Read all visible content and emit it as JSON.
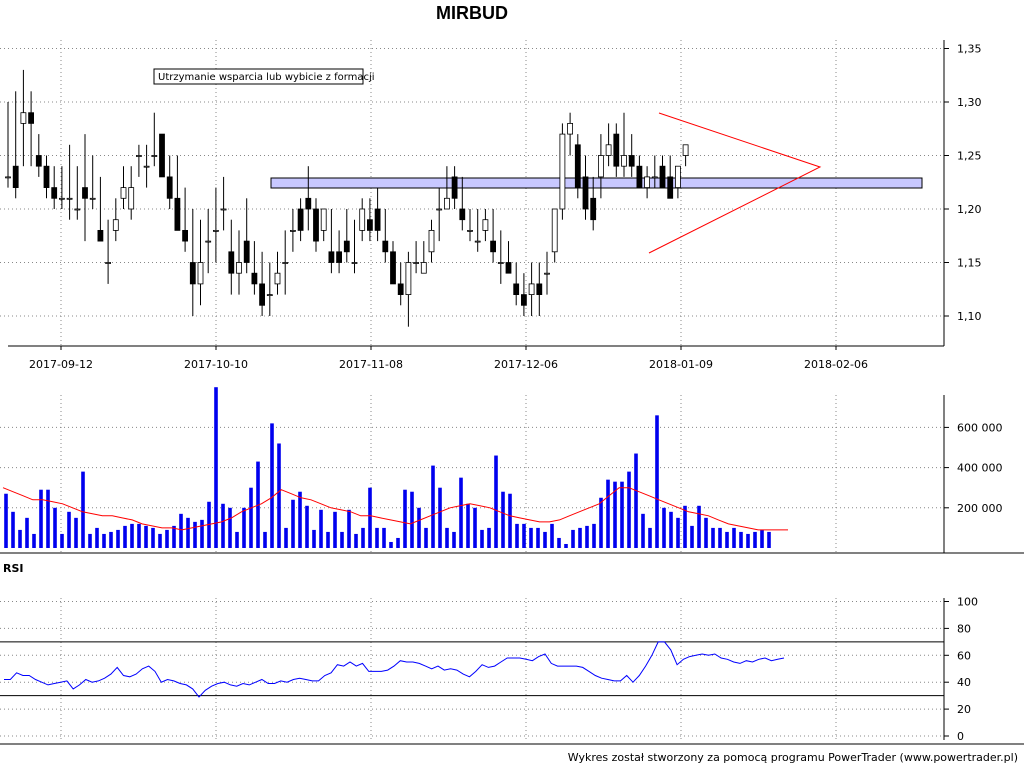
{
  "chart_data": [
    {
      "type": "candlestick",
      "title": "MIRBUD",
      "annotation": "Utrzymanie wsparcia lub wybicie z formacji",
      "x_ticks": [
        "2017-09-12",
        "2017-10-10",
        "2017-11-08",
        "2017-12-06",
        "2018-01-09",
        "2018-02-06"
      ],
      "y_ticks": [
        "1,10",
        "1,15",
        "1,20",
        "1,25",
        "1,30",
        "1,35"
      ],
      "ylim": [
        1.08,
        1.37
      ],
      "grid": true,
      "support_zone": [
        1.221,
        1.231
      ],
      "triangle": {
        "top": [
          1.29,
          1.24
        ],
        "bottom": [
          1.16,
          1.24
        ]
      },
      "ohlc": [
        [
          1.23,
          1.3,
          1.22,
          1.23
        ],
        [
          1.24,
          1.31,
          1.21,
          1.22
        ],
        [
          1.28,
          1.33,
          1.24,
          1.29
        ],
        [
          1.29,
          1.31,
          1.24,
          1.28
        ],
        [
          1.25,
          1.27,
          1.23,
          1.24
        ],
        [
          1.24,
          1.25,
          1.21,
          1.22
        ],
        [
          1.22,
          1.24,
          1.2,
          1.21
        ],
        [
          1.21,
          1.24,
          1.2,
          1.21
        ],
        [
          1.21,
          1.26,
          1.19,
          1.21
        ],
        [
          1.2,
          1.24,
          1.19,
          1.2
        ],
        [
          1.22,
          1.27,
          1.17,
          1.21
        ],
        [
          1.21,
          1.25,
          1.2,
          1.21
        ],
        [
          1.18,
          1.23,
          1.17,
          1.17
        ],
        [
          1.15,
          1.19,
          1.13,
          1.15
        ],
        [
          1.18,
          1.21,
          1.17,
          1.19
        ],
        [
          1.21,
          1.24,
          1.2,
          1.22
        ],
        [
          1.2,
          1.24,
          1.19,
          1.22
        ],
        [
          1.25,
          1.26,
          1.23,
          1.25
        ],
        [
          1.24,
          1.26,
          1.22,
          1.24
        ],
        [
          1.25,
          1.29,
          1.24,
          1.25
        ],
        [
          1.27,
          1.27,
          1.23,
          1.23
        ],
        [
          1.23,
          1.25,
          1.2,
          1.21
        ],
        [
          1.21,
          1.25,
          1.18,
          1.18
        ],
        [
          1.18,
          1.22,
          1.16,
          1.17
        ],
        [
          1.15,
          1.2,
          1.1,
          1.13
        ],
        [
          1.13,
          1.19,
          1.11,
          1.15
        ],
        [
          1.17,
          1.2,
          1.14,
          1.17
        ],
        [
          1.18,
          1.22,
          1.15,
          1.18
        ],
        [
          1.2,
          1.23,
          1.18,
          1.2
        ],
        [
          1.16,
          1.19,
          1.12,
          1.14
        ],
        [
          1.14,
          1.18,
          1.12,
          1.15
        ],
        [
          1.17,
          1.21,
          1.14,
          1.15
        ],
        [
          1.14,
          1.17,
          1.12,
          1.13
        ],
        [
          1.13,
          1.16,
          1.1,
          1.11
        ],
        [
          1.12,
          1.15,
          1.1,
          1.12
        ],
        [
          1.13,
          1.16,
          1.12,
          1.14
        ],
        [
          1.15,
          1.18,
          1.12,
          1.15
        ],
        [
          1.18,
          1.2,
          1.16,
          1.18
        ],
        [
          1.2,
          1.21,
          1.17,
          1.18
        ],
        [
          1.21,
          1.24,
          1.18,
          1.2
        ],
        [
          1.2,
          1.21,
          1.16,
          1.17
        ],
        [
          1.18,
          1.2,
          1.17,
          1.2
        ],
        [
          1.16,
          1.2,
          1.14,
          1.15
        ],
        [
          1.16,
          1.18,
          1.14,
          1.15
        ],
        [
          1.17,
          1.2,
          1.15,
          1.16
        ],
        [
          1.15,
          1.19,
          1.14,
          1.15
        ],
        [
          1.18,
          1.21,
          1.17,
          1.2
        ],
        [
          1.19,
          1.21,
          1.17,
          1.18
        ],
        [
          1.2,
          1.22,
          1.17,
          1.18
        ],
        [
          1.17,
          1.2,
          1.15,
          1.16
        ],
        [
          1.16,
          1.17,
          1.13,
          1.13
        ],
        [
          1.13,
          1.15,
          1.11,
          1.12
        ],
        [
          1.12,
          1.16,
          1.09,
          1.15
        ],
        [
          1.15,
          1.17,
          1.14,
          1.15
        ],
        [
          1.14,
          1.17,
          1.14,
          1.15
        ],
        [
          1.16,
          1.19,
          1.15,
          1.18
        ],
        [
          1.2,
          1.22,
          1.17,
          1.2
        ],
        [
          1.2,
          1.24,
          1.2,
          1.21
        ],
        [
          1.23,
          1.24,
          1.2,
          1.21
        ],
        [
          1.2,
          1.23,
          1.18,
          1.19
        ],
        [
          1.18,
          1.2,
          1.17,
          1.18
        ],
        [
          1.17,
          1.2,
          1.16,
          1.17
        ],
        [
          1.18,
          1.2,
          1.17,
          1.19
        ],
        [
          1.17,
          1.2,
          1.15,
          1.16
        ],
        [
          1.15,
          1.18,
          1.13,
          1.15
        ],
        [
          1.15,
          1.17,
          1.14,
          1.14
        ],
        [
          1.13,
          1.15,
          1.11,
          1.12
        ],
        [
          1.12,
          1.14,
          1.1,
          1.11
        ],
        [
          1.12,
          1.15,
          1.1,
          1.13
        ],
        [
          1.13,
          1.15,
          1.1,
          1.12
        ],
        [
          1.14,
          1.16,
          1.12,
          1.14
        ],
        [
          1.16,
          1.2,
          1.15,
          1.2
        ],
        [
          1.2,
          1.28,
          1.19,
          1.27
        ],
        [
          1.27,
          1.29,
          1.25,
          1.28
        ],
        [
          1.26,
          1.27,
          1.21,
          1.22
        ],
        [
          1.23,
          1.25,
          1.19,
          1.2
        ],
        [
          1.21,
          1.23,
          1.18,
          1.19
        ],
        [
          1.23,
          1.27,
          1.21,
          1.25
        ],
        [
          1.25,
          1.28,
          1.24,
          1.26
        ],
        [
          1.27,
          1.28,
          1.23,
          1.24
        ],
        [
          1.24,
          1.29,
          1.23,
          1.25
        ],
        [
          1.25,
          1.27,
          1.23,
          1.24
        ],
        [
          1.24,
          1.25,
          1.22,
          1.22
        ],
        [
          1.22,
          1.24,
          1.21,
          1.23
        ],
        [
          1.23,
          1.25,
          1.22,
          1.23
        ],
        [
          1.24,
          1.25,
          1.22,
          1.22
        ],
        [
          1.23,
          1.25,
          1.21,
          1.21
        ],
        [
          1.22,
          1.24,
          1.21,
          1.24
        ],
        [
          1.25,
          1.26,
          1.24,
          1.26
        ]
      ]
    },
    {
      "type": "bar",
      "y_ticks": [
        "200 000",
        "400 000",
        "600 000"
      ],
      "ylim": [
        0,
        800000
      ],
      "values": [
        270000,
        180000,
        90000,
        150000,
        70000,
        290000,
        290000,
        200000,
        70000,
        180000,
        150000,
        380000,
        70000,
        100000,
        70000,
        80000,
        90000,
        110000,
        120000,
        120000,
        110000,
        100000,
        70000,
        90000,
        110000,
        170000,
        150000,
        130000,
        140000,
        230000,
        800000,
        220000,
        200000,
        80000,
        200000,
        300000,
        430000,
        80000,
        620000,
        520000,
        100000,
        240000,
        280000,
        210000,
        90000,
        190000,
        80000,
        180000,
        80000,
        190000,
        70000,
        100000,
        300000,
        100000,
        100000,
        30000,
        50000,
        290000,
        280000,
        200000,
        100000,
        410000,
        300000,
        100000,
        80000,
        350000,
        220000,
        200000,
        90000,
        100000,
        460000,
        280000,
        270000,
        120000,
        120000,
        100000,
        100000,
        80000,
        120000,
        50000,
        20000,
        90000,
        100000,
        110000,
        120000,
        250000,
        340000,
        330000,
        330000,
        380000,
        470000,
        170000,
        100000,
        660000,
        200000,
        180000,
        150000,
        210000,
        110000,
        210000,
        150000,
        100000,
        100000,
        80000,
        100000,
        80000,
        70000,
        80000,
        90000,
        80000
      ],
      "ma_values": [
        300000,
        280000,
        260000,
        240000,
        240000,
        230000,
        220000,
        200000,
        180000,
        170000,
        160000,
        160000,
        150000,
        140000,
        120000,
        110000,
        100000,
        100000,
        90000,
        100000,
        110000,
        120000,
        130000,
        150000,
        180000,
        200000,
        220000,
        250000,
        290000,
        270000,
        250000,
        240000,
        220000,
        200000,
        190000,
        180000,
        160000,
        160000,
        150000,
        140000,
        130000,
        120000,
        140000,
        160000,
        180000,
        200000,
        210000,
        220000,
        210000,
        200000,
        180000,
        160000,
        150000,
        140000,
        130000,
        130000,
        140000,
        160000,
        180000,
        200000,
        220000,
        260000,
        300000,
        300000,
        280000,
        260000,
        240000,
        220000,
        200000,
        180000,
        170000,
        160000,
        140000,
        120000,
        110000,
        100000,
        90000,
        90000,
        90000,
        90000
      ]
    },
    {
      "type": "line",
      "label": "RSI",
      "y_ticks": [
        "0",
        "20",
        "40",
        "60",
        "80",
        "100"
      ],
      "ylim": [
        0,
        100
      ],
      "levels": [
        30,
        70
      ],
      "values": [
        42,
        42,
        47,
        45,
        45,
        42,
        40,
        38,
        39,
        40,
        41,
        35,
        38,
        42,
        40,
        41,
        43,
        46,
        51,
        45,
        44,
        46,
        50,
        52,
        48,
        40,
        42,
        41,
        39,
        38,
        35,
        29,
        34,
        37,
        39,
        40,
        38,
        37,
        39,
        38,
        40,
        42,
        39,
        39,
        41,
        40,
        42,
        43,
        42,
        41,
        41,
        45,
        47,
        53,
        52,
        55,
        52,
        54,
        48,
        48,
        48,
        49,
        52,
        56,
        55,
        55,
        54,
        52,
        50,
        52,
        49,
        50,
        49,
        46,
        44,
        48,
        53,
        51,
        52,
        55,
        58,
        58,
        58,
        57,
        56,
        59,
        61,
        54,
        52,
        52,
        52,
        52,
        51,
        48,
        45,
        43,
        42,
        41,
        41,
        45,
        40,
        45,
        52,
        60,
        70,
        70,
        64,
        53,
        57,
        59,
        60,
        61,
        60,
        61,
        58,
        57,
        55,
        54,
        56,
        55,
        57,
        58,
        56,
        57,
        58
      ]
    },
    {
      "credit": "Wykres został stworzony za pomocą programu PowerTrader (www.powertrader.pl)",
      "colors": {
        "up": "#008000",
        "down_marker": "#cc0000",
        "volume": "#0000ee",
        "ma": "#ff0000",
        "rsi": "#0000ff",
        "zone": "#c8c8ff"
      }
    }
  ]
}
